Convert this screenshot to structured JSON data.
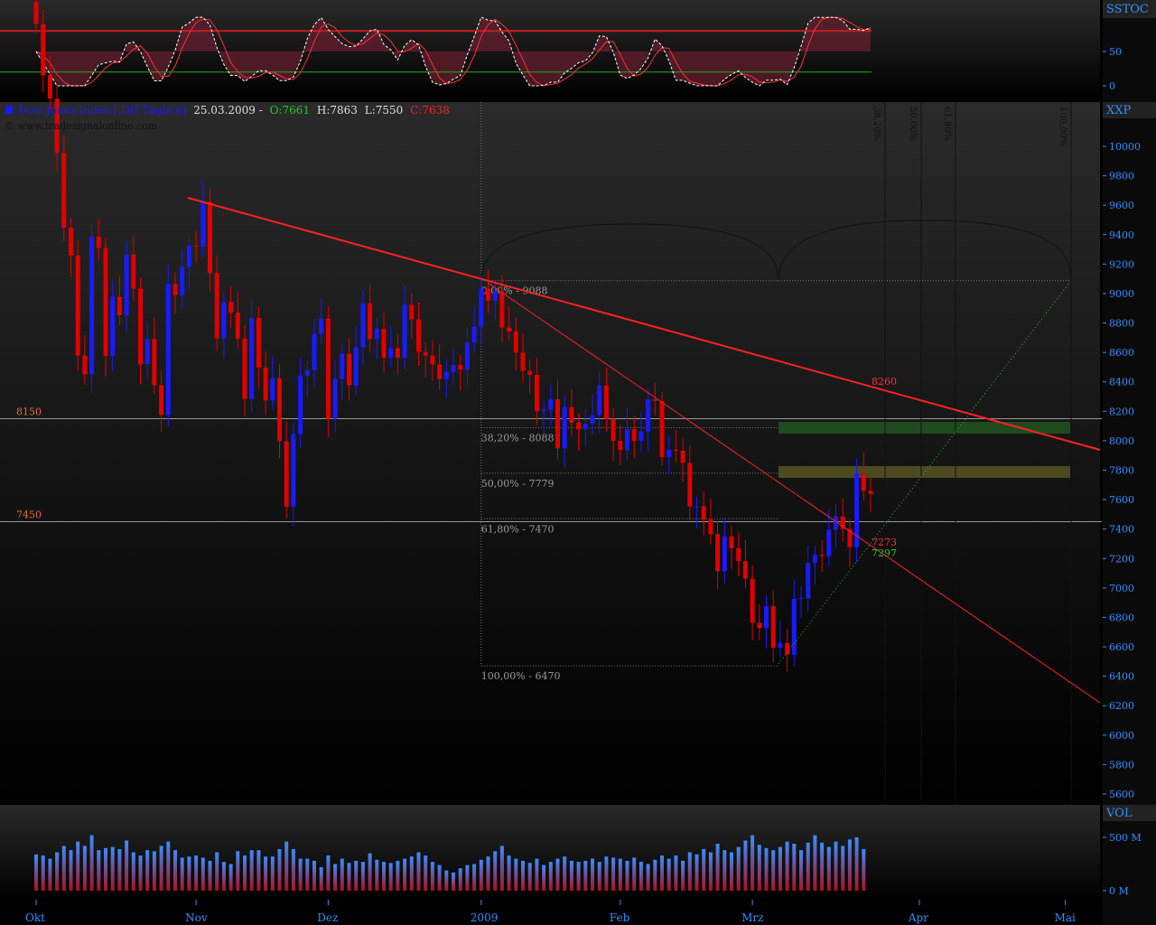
{
  "header": {
    "name": "Dow Jones Index [.DJI  Täglich]",
    "date": "25.03.2009 -",
    "open": "O:7661",
    "high": "H:7863",
    "low": "L:7550",
    "close": "C:7638",
    "copyright": "© www.tradesignalonline.com"
  },
  "panels": {
    "stoch": "SSTOC",
    "price": "XXP",
    "volume": "VOL"
  },
  "colors": {
    "up": "#1a1aff",
    "down": "#e00000",
    "axis": "#2f8fff",
    "trend": "#ff2020",
    "green": "#22cc22"
  },
  "chart_data": [
    {
      "type": "candlestick",
      "title": "Dow Jones Index [.DJI Täglich]",
      "ylim": [
        5600,
        10000
      ],
      "yticks": [
        5600,
        5800,
        6000,
        6200,
        6400,
        6600,
        6800,
        7000,
        7200,
        7400,
        7600,
        7800,
        8000,
        8200,
        8400,
        8600,
        8800,
        9000,
        9200,
        9400,
        9600,
        9800,
        10000
      ],
      "xticks": [
        {
          "label": "Okt",
          "index": 0
        },
        {
          "label": "Nov",
          "index": 23
        },
        {
          "label": "Dez",
          "index": 42
        },
        {
          "label": "2009",
          "index": 64
        },
        {
          "label": "Feb",
          "index": 84
        },
        {
          "label": "Mrz",
          "index": 103
        },
        {
          "label": "Apr",
          "index": 127
        },
        {
          "label": "Mai",
          "index": 148
        }
      ],
      "closes": [
        10831,
        10482,
        10325,
        9955,
        9447,
        9258,
        8579,
        8451,
        9387,
        9310,
        8577,
        8979,
        8852,
        9265,
        9033,
        8519,
        8691,
        8378,
        8175,
        9065,
        8990,
        9180,
        9325,
        9319,
        9625,
        9139,
        8695,
        8943,
        8870,
        8694,
        8283,
        8835,
        8497,
        8273,
        8424,
        7997,
        7552,
        8046,
        8443,
        8479,
        8726,
        8829,
        8149,
        8419,
        8591,
        8376,
        8635,
        8934,
        8691,
        8761,
        8565,
        8629,
        8564,
        8924,
        8824,
        8604,
        8579,
        8519,
        8419,
        8468,
        8515,
        8483,
        8668,
        8776,
        9034,
        8952,
        9015,
        8769,
        8742,
        8599,
        8474,
        8448,
        8200,
        8212,
        8281,
        7949,
        8228,
        8122,
        8077,
        8116,
        8175,
        8375,
        8149,
        8000,
        7936,
        8078,
        8000,
        8063,
        8280,
        8270,
        7888,
        7939,
        7932,
        7850,
        7553,
        7555,
        7465,
        7366,
        7114,
        7350,
        7270,
        7182,
        7063,
        6763,
        6726,
        6876,
        6594,
        6627,
        6547,
        6926,
        6930,
        7170,
        7224,
        7216,
        7395,
        7486,
        7400,
        7278,
        7776,
        7660,
        7638
      ],
      "horizontal_levels": [
        {
          "label": "8150",
          "value": 8150
        },
        {
          "label": "7450",
          "value": 7450
        }
      ],
      "fibonacci": [
        {
          "label": "0,00% - 9088",
          "value": 9088
        },
        {
          "label": "38,20% - 8088",
          "value": 8088
        },
        {
          "label": "50,00% - 7779",
          "value": 7779
        },
        {
          "label": "61,80% - 7470",
          "value": 7470
        },
        {
          "label": "100,00% - 6470",
          "value": 6470
        }
      ],
      "time_fib": [
        "38,20%",
        "50,00%",
        "61,80%",
        "100,00%"
      ],
      "annotations": {
        "trend": "8260",
        "res": "7273",
        "sup": "7297"
      }
    },
    {
      "type": "line",
      "title": "SSTOC",
      "yticks": [
        "50",
        "0"
      ]
    },
    {
      "type": "bar",
      "title": "VOL",
      "yticks": [
        "500 M",
        "0 M"
      ],
      "values": [
        340,
        330,
        300,
        360,
        420,
        380,
        460,
        420,
        520,
        380,
        400,
        410,
        390,
        470,
        360,
        330,
        380,
        370,
        420,
        460,
        380,
        310,
        320,
        330,
        310,
        280,
        360,
        270,
        250,
        370,
        330,
        380,
        380,
        320,
        320,
        390,
        460,
        390,
        300,
        300,
        280,
        220,
        330,
        250,
        300,
        260,
        280,
        270,
        350,
        290,
        270,
        260,
        280,
        300,
        320,
        360,
        330,
        270,
        240,
        190,
        170,
        210,
        240,
        250,
        290,
        320,
        370,
        420,
        330,
        300,
        280,
        260,
        300,
        240,
        270,
        300,
        320,
        280,
        270,
        280,
        300,
        270,
        320,
        310,
        300,
        280,
        310,
        270,
        250,
        290,
        330,
        300,
        330,
        280,
        360,
        340,
        390,
        360,
        440,
        380,
        360,
        410,
        470,
        520,
        430,
        400,
        380,
        410,
        460,
        440,
        380,
        450,
        520,
        450,
        410,
        460,
        420,
        480,
        500,
        390
      ]
    }
  ]
}
